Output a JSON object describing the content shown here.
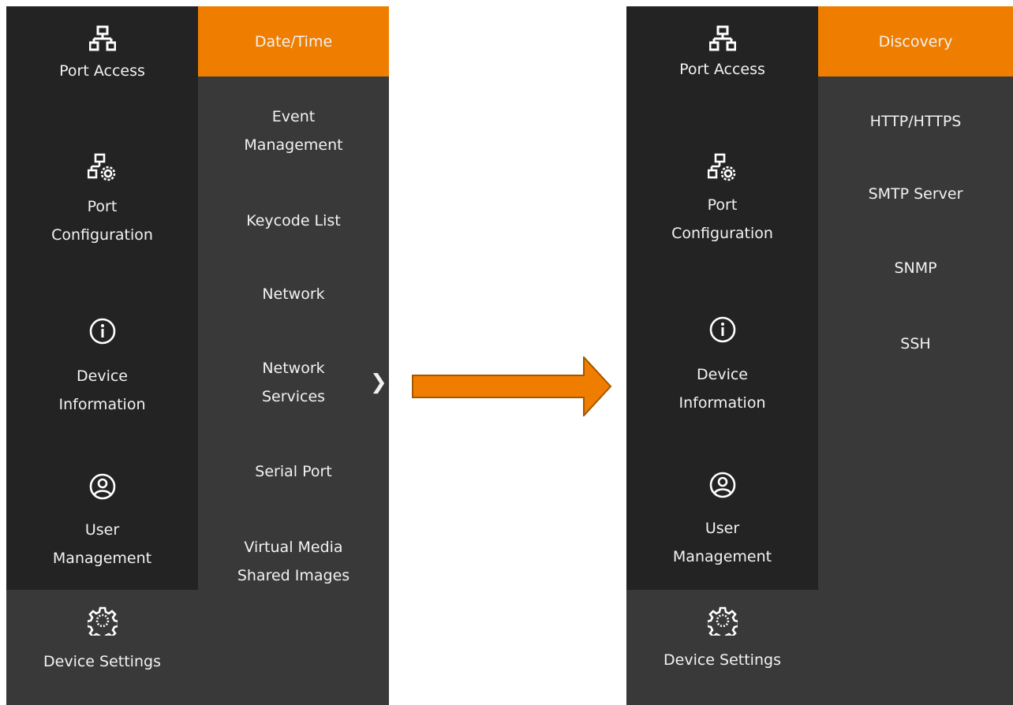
{
  "left_panel": {
    "sidebar": [
      {
        "icon": "network-icon",
        "label": "Port Access"
      },
      {
        "icon": "network-gear-icon",
        "label": "Port\nConfiguration"
      },
      {
        "icon": "info-icon",
        "label": "Device\nInformation"
      },
      {
        "icon": "user-icon",
        "label": "User\nManagement"
      }
    ],
    "bottom": {
      "icon": "gear-icon",
      "label": "Device Settings"
    },
    "submenu": {
      "active": "Date/Time",
      "items": [
        "Event\nManagement",
        "Keycode List",
        "Network",
        "Network\nServices",
        "Serial Port",
        "Virtual Media\nShared Images"
      ]
    }
  },
  "right_panel": {
    "sidebar": [
      {
        "icon": "network-icon",
        "label": "Port Access"
      },
      {
        "icon": "network-gear-icon",
        "label": "Port\nConfiguration"
      },
      {
        "icon": "info-icon",
        "label": "Device\nInformation"
      },
      {
        "icon": "user-icon",
        "label": "User\nManagement"
      }
    ],
    "bottom": {
      "icon": "gear-icon",
      "label": "Device Settings"
    },
    "submenu": {
      "active": "Discovery",
      "items": [
        "HTTP/HTTPS",
        "SMTP Server",
        "SNMP",
        "SSH"
      ]
    }
  },
  "colors": {
    "accent": "#ef7d00",
    "sidebar_bg": "#232323",
    "panel_bg": "#393939"
  }
}
